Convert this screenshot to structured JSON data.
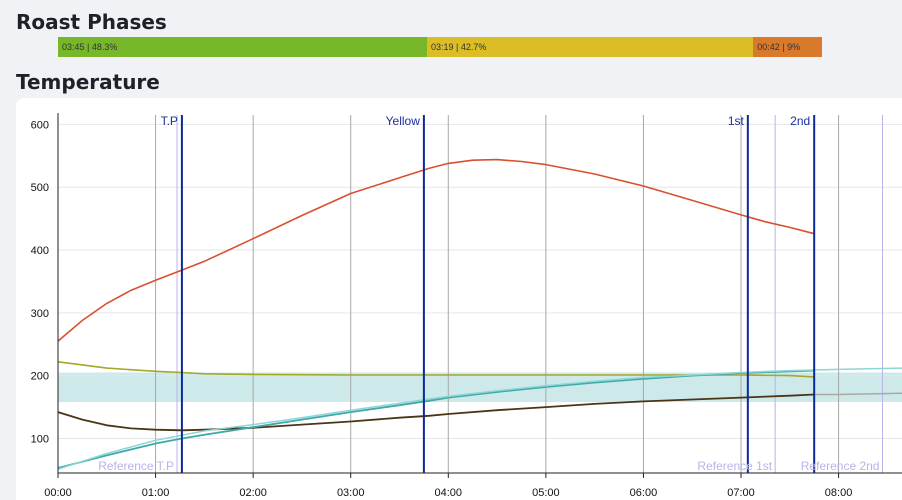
{
  "sections": {
    "phases_title": "Roast Phases",
    "temperature_title": "Temperature"
  },
  "phases": [
    {
      "label": "03:45 | 48.3%",
      "fraction": 0.483,
      "color": "#76b82a"
    },
    {
      "label": "03:19 | 42.7%",
      "fraction": 0.427,
      "color": "#dbbd28"
    },
    {
      "label": "00:42 | 9%",
      "fraction": 0.09,
      "color": "#d87a2a"
    }
  ],
  "chart_data": {
    "type": "line",
    "x_unit": "minutes",
    "xlim": [
      0,
      8.65
    ],
    "ylim": [
      45,
      615
    ],
    "x_ticks": [
      {
        "value": 0,
        "label": "00:00"
      },
      {
        "value": 1,
        "label": "01:00"
      },
      {
        "value": 2,
        "label": "02:00"
      },
      {
        "value": 3,
        "label": "03:00"
      },
      {
        "value": 4,
        "label": "04:00"
      },
      {
        "value": 5,
        "label": "05:00"
      },
      {
        "value": 6,
        "label": "06:00"
      },
      {
        "value": 7,
        "label": "07:00"
      },
      {
        "value": 8,
        "label": "08:00"
      }
    ],
    "y_ticks": [
      100,
      200,
      300,
      400,
      500,
      600
    ],
    "reference_band": {
      "y_low": 158,
      "y_high": 205,
      "color": "#cde9ea"
    },
    "gridlines": [
      1.0,
      2.0,
      3.0,
      4.0,
      5.0,
      6.0,
      7.0,
      8.0
    ],
    "series": [
      {
        "color": "#d9502e",
        "width": 1.6,
        "x": [
          0,
          0.25,
          0.5,
          0.75,
          1.0,
          1.27,
          1.5,
          2.0,
          2.5,
          3.0,
          3.5,
          3.8,
          4.0,
          4.25,
          4.5,
          4.75,
          5.0,
          5.5,
          6.0,
          6.5,
          7.0,
          7.25,
          7.5,
          7.75
        ],
        "y": [
          255,
          288,
          315,
          336,
          352,
          368,
          382,
          418,
          455,
          490,
          515,
          530,
          538,
          543,
          544,
          541,
          536,
          521,
          502,
          479,
          456,
          445,
          436,
          426
        ]
      },
      {
        "color": "#a3a826",
        "width": 1.6,
        "x": [
          0,
          0.5,
          1.0,
          1.27,
          1.5,
          2.0,
          3.0,
          4.0,
          5.0,
          6.0,
          7.0,
          7.5,
          7.75
        ],
        "y": [
          222,
          212,
          207,
          205,
          203,
          202,
          201,
          201,
          201,
          201,
          201,
          200,
          198
        ]
      },
      {
        "color": "#4a3515",
        "width": 1.8,
        "x": [
          0,
          0.25,
          0.5,
          0.75,
          1.0,
          1.27,
          1.5,
          2.0,
          2.5,
          3.0,
          3.5,
          3.8,
          4.0,
          4.5,
          5.0,
          5.5,
          6.0,
          6.5,
          7.0,
          7.5,
          7.75
        ],
        "y": [
          142,
          130,
          121,
          116,
          114,
          113,
          114,
          117,
          122,
          127,
          133,
          136,
          139,
          145,
          150,
          155,
          159,
          162,
          165,
          168,
          170
        ]
      },
      {
        "color": "#a9aba3",
        "width": 1.5,
        "x": [
          7.75,
          8.0,
          8.65
        ],
        "y": [
          170,
          170,
          172
        ]
      },
      {
        "color": "#3fa9a9",
        "width": 1.8,
        "x": [
          0,
          0.5,
          1.0,
          1.27,
          1.5,
          2.0,
          2.5,
          3.0,
          3.5,
          3.8,
          4.0,
          4.5,
          5.0,
          5.5,
          6.0,
          6.5,
          7.0,
          7.5,
          7.75
        ],
        "y": [
          53,
          73,
          92,
          100,
          106,
          118,
          130,
          142,
          153,
          160,
          165,
          174,
          182,
          189,
          195,
          200,
          204,
          207,
          208
        ]
      },
      {
        "color": "#8ed5d5",
        "width": 1.5,
        "x": [
          0,
          0.5,
          1.0,
          1.5,
          2.0,
          2.5,
          3.0,
          3.5,
          4.0,
          4.5,
          5.0,
          5.5,
          6.0,
          6.5,
          7.0,
          7.5,
          8.0,
          8.65
        ],
        "y": [
          51,
          76,
          97,
          112,
          122,
          133,
          145,
          156,
          167,
          176,
          184,
          191,
          197,
          201,
          205,
          208,
          210,
          212
        ]
      }
    ],
    "events": [
      {
        "label": "T.P",
        "x": 1.27
      },
      {
        "label": "Yellow",
        "x": 3.75
      },
      {
        "label": "1st",
        "x": 7.07
      },
      {
        "label": "2nd",
        "x": 7.75
      }
    ],
    "reference_events": [
      {
        "label": "Reference T.P",
        "x": 1.22
      },
      {
        "label": "Reference 1st",
        "x": 7.35
      },
      {
        "label": "Reference 2nd",
        "x": 8.45
      }
    ]
  }
}
